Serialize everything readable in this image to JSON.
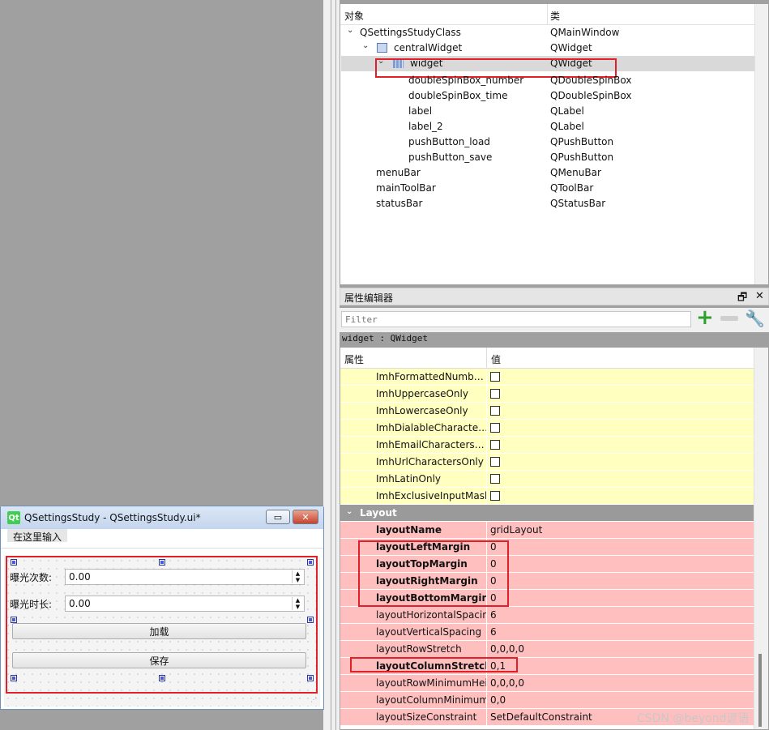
{
  "form_window": {
    "title": "QSettingsStudy - QSettingsStudy.ui*",
    "logo": "Qt",
    "min_icon": "▭",
    "close_icon": "✕",
    "menu_input": "在这里输入",
    "label_count": "曝光次数:",
    "label_time": "曝光时长:",
    "value_count": "0.00",
    "value_time": "0.00",
    "load_label": "加载",
    "save_label": "保存"
  },
  "object_inspector": {
    "col_object": "对象",
    "col_class": "类",
    "rows": [
      {
        "name": "QSettingsStudyClass",
        "cls": "QMainWindow"
      },
      {
        "name": "centralWidget",
        "cls": "QWidget"
      },
      {
        "name": "widget",
        "cls": "QWidget"
      },
      {
        "name": "doubleSpinBox_number",
        "cls": "QDoubleSpinBox"
      },
      {
        "name": "doubleSpinBox_time",
        "cls": "QDoubleSpinBox"
      },
      {
        "name": "label",
        "cls": "QLabel"
      },
      {
        "name": "label_2",
        "cls": "QLabel"
      },
      {
        "name": "pushButton_load",
        "cls": "QPushButton"
      },
      {
        "name": "pushButton_save",
        "cls": "QPushButton"
      },
      {
        "name": "menuBar",
        "cls": "QMenuBar"
      },
      {
        "name": "mainToolBar",
        "cls": "QToolBar"
      },
      {
        "name": "statusBar",
        "cls": "QStatusBar"
      }
    ]
  },
  "property_editor": {
    "title": "属性编辑器",
    "float_icon": "🗗",
    "close_icon": "✕",
    "filter_placeholder": "Filter",
    "plus_icon": "+",
    "wrench_icon": "🔧",
    "class_label": "widget : QWidget",
    "col_property": "属性",
    "col_value": "值",
    "rows": [
      {
        "name": "ImhFormattedNumb…",
        "value": ""
      },
      {
        "name": "ImhUppercaseOnly",
        "value": ""
      },
      {
        "name": "ImhLowercaseOnly",
        "value": ""
      },
      {
        "name": "ImhDialableCharacte…",
        "value": ""
      },
      {
        "name": "ImhEmailCharacters…",
        "value": ""
      },
      {
        "name": "ImhUrlCharactersOnly",
        "value": ""
      },
      {
        "name": "ImhLatinOnly",
        "value": ""
      },
      {
        "name": "ImhExclusiveInputMask",
        "value": ""
      },
      {
        "name": "Layout",
        "value": ""
      },
      {
        "name": "layoutName",
        "value": "gridLayout"
      },
      {
        "name": "layoutLeftMargin",
        "value": "0"
      },
      {
        "name": "layoutTopMargin",
        "value": "0"
      },
      {
        "name": "layoutRightMargin",
        "value": "0"
      },
      {
        "name": "layoutBottomMargin",
        "value": "0"
      },
      {
        "name": "layoutHorizontalSpacing",
        "value": "6"
      },
      {
        "name": "layoutVerticalSpacing",
        "value": "6"
      },
      {
        "name": "layoutRowStretch",
        "value": "0,0,0,0"
      },
      {
        "name": "layoutColumnStretch",
        "value": "0,1"
      },
      {
        "name": "layoutRowMinimumHeight",
        "value": "0,0,0,0"
      },
      {
        "name": "layoutColumnMinimum…",
        "value": "0,0"
      },
      {
        "name": "layoutSizeConstraint",
        "value": "SetDefaultConstraint"
      }
    ]
  },
  "watermark": "CSDN @beyond谚语",
  "colors": {
    "highlight_red": "#e2202a",
    "yellow_row": "#ffffbf",
    "pink_row": "#ffbfbf",
    "group_row": "#9a9a9a"
  }
}
